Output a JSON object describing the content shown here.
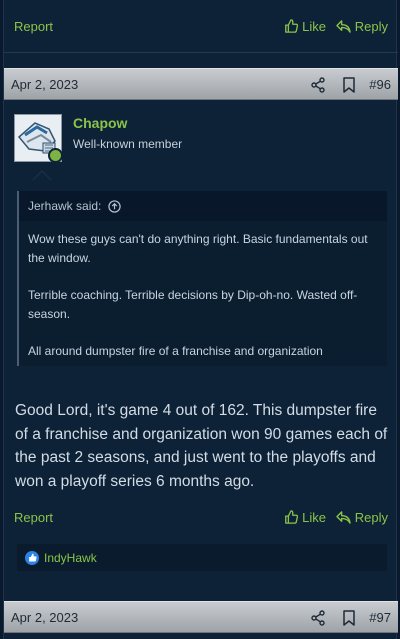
{
  "top_actions": {
    "report": "Report",
    "like": "Like",
    "reply": "Reply"
  },
  "post": {
    "date": "Apr 2, 2023",
    "number": "#96",
    "user": {
      "name": "Chapow",
      "title": "Well-known member"
    },
    "quote": {
      "author": "Jerhawk said:",
      "paragraphs": [
        "Wow these guys can't do anything right. Basic fundamentals out the window.",
        "Terrible coaching. Terrible decisions by Dip-oh-no. Wasted off-season.",
        "All around dumpster fire of a franchise and organization"
      ]
    },
    "message": "Good Lord, it's game 4 out of 162. This dumpster fire of a franchise and organization won 90 games each of the past 2 seasons, and just went to the playoffs and won a playoff series 6 months ago.",
    "actions": {
      "report": "Report",
      "like": "Like",
      "reply": "Reply"
    },
    "reactions": {
      "users": "IndyHawk"
    }
  },
  "next_post": {
    "date": "Apr 2, 2023",
    "number": "#97"
  },
  "colors": {
    "accent": "#8bc34a",
    "background": "#0d2236",
    "header": "#b4b8bd"
  }
}
